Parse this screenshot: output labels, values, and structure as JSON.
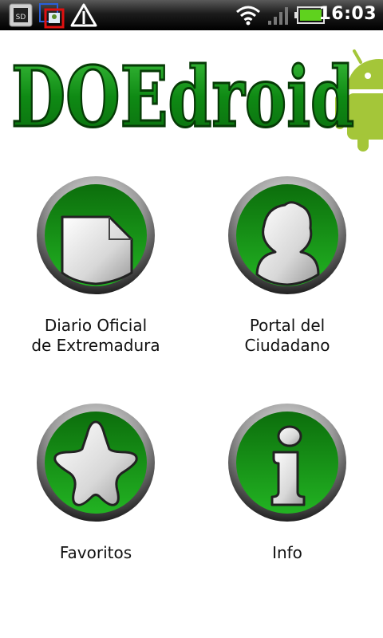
{
  "status_bar": {
    "time": "16:03",
    "icons": [
      "sd-card-icon",
      "notification-icon",
      "warning-icon",
      "wifi-icon",
      "signal-icon",
      "battery-icon"
    ]
  },
  "logo": {
    "text": "DOEdroid"
  },
  "menu": {
    "diario": {
      "line1": "Diario Oficial",
      "line2": "de Extremadura",
      "icon": "document-icon"
    },
    "portal": {
      "line1": "Portal del",
      "line2": "Ciudadano",
      "icon": "person-icon"
    },
    "favoritos": {
      "label": "Favoritos",
      "icon": "star-icon"
    },
    "info": {
      "label": "Info",
      "icon": "info-icon"
    }
  },
  "colors": {
    "green_dark": "#0a6d0a",
    "green_light": "#2bb52b",
    "android_green": "#a4c639"
  }
}
